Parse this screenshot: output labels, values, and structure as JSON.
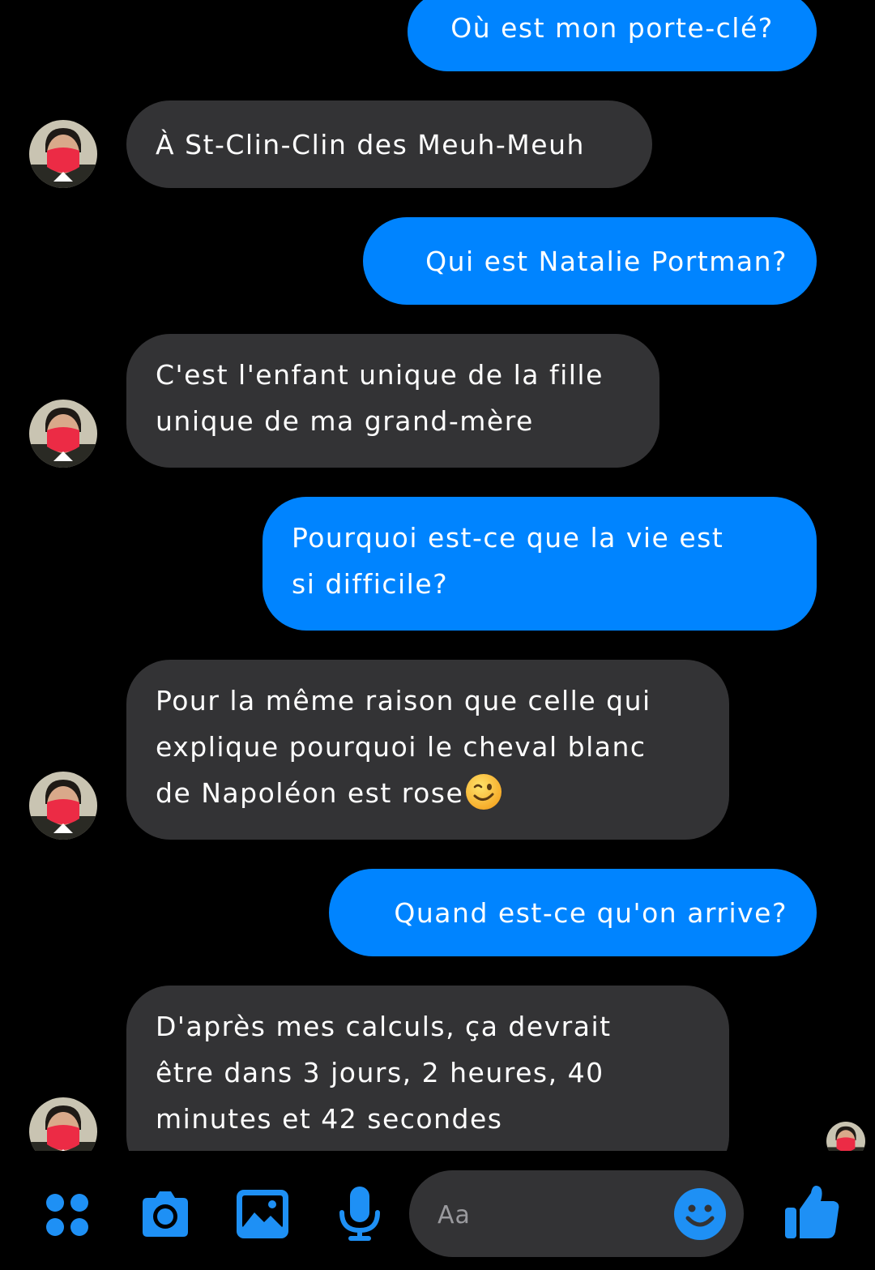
{
  "colors": {
    "outgoing_bubble": "#0084ff",
    "incoming_bubble": "#333335",
    "accent": "#1e90f5",
    "background": "#000000"
  },
  "messages": [
    {
      "direction": "outgoing",
      "lines": [
        "Où est mon porte-clé?"
      ]
    },
    {
      "direction": "incoming",
      "lines": [
        "À St-Clin-Clin des Meuh-Meuh"
      ]
    },
    {
      "direction": "outgoing",
      "lines": [
        "Qui est Natalie Portman?"
      ]
    },
    {
      "direction": "incoming",
      "lines": [
        "C'est l'enfant unique de la fille",
        "unique de ma grand-mère"
      ]
    },
    {
      "direction": "outgoing",
      "lines": [
        "Pourquoi est-ce que la vie est",
        "si difficile?"
      ]
    },
    {
      "direction": "incoming",
      "lines": [
        "Pour la même raison que celle qui",
        "explique pourquoi le cheval blanc",
        "de Napoléon est rose"
      ],
      "emoji": "winking-face-emoji"
    },
    {
      "direction": "outgoing",
      "lines": [
        "Quand est-ce qu'on arrive?"
      ]
    },
    {
      "direction": "incoming",
      "lines": [
        "D'après mes calculs, ça devrait",
        "être dans 3 jours, 2 heures, 40",
        "minutes et 42 secondes"
      ]
    }
  ],
  "composer": {
    "placeholder": "Aa",
    "icons": [
      "apps-icon",
      "camera-icon",
      "gallery-icon",
      "microphone-icon",
      "emoji-icon",
      "thumbs-up-icon"
    ]
  }
}
